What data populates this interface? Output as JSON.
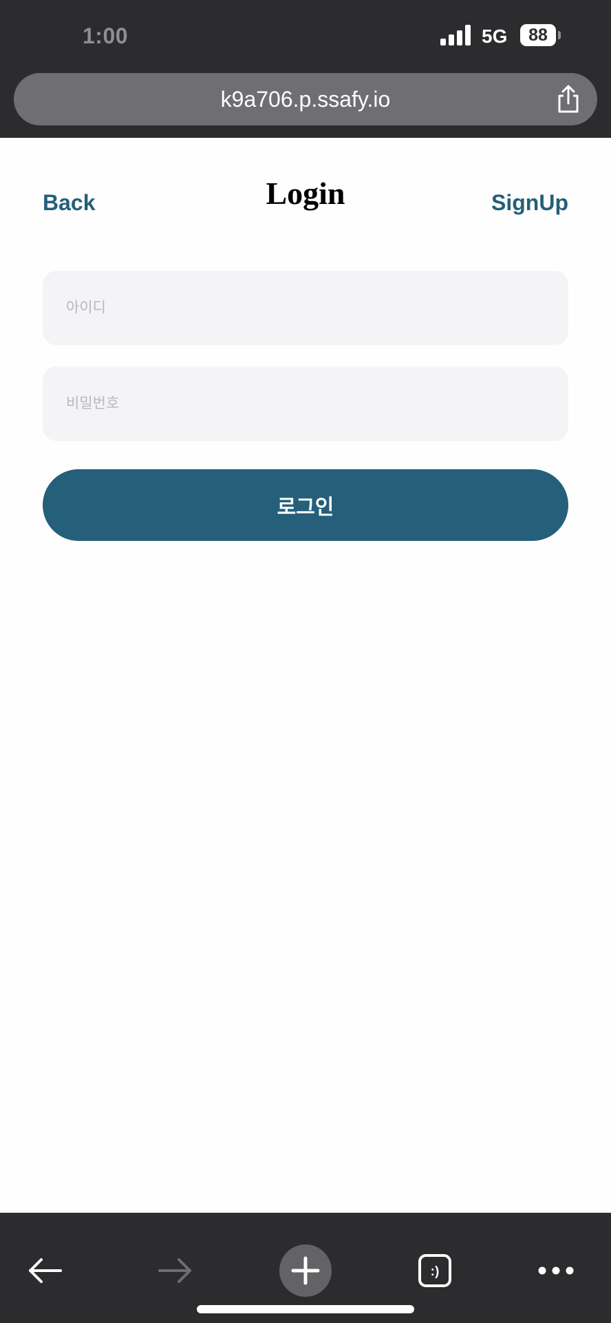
{
  "status_bar": {
    "time": "1:00",
    "network": "5G",
    "battery": "88",
    "signal_bars": 4
  },
  "browser": {
    "url": "k9a706.p.ssafy.io",
    "share_icon": "share-icon"
  },
  "header": {
    "back_label": "Back",
    "title": "Login",
    "signup_label": "SignUp"
  },
  "form": {
    "id_placeholder": "아이디",
    "id_value": "",
    "password_placeholder": "비밀번호",
    "password_value": "",
    "submit_label": "로그인"
  },
  "toolbar": {
    "icons": [
      "back-arrow-icon",
      "forward-arrow-icon",
      "plus-icon",
      "tabs-icon",
      "more-icon"
    ],
    "tabs_icon_text": ":)"
  },
  "colors": {
    "accent": "#255f79",
    "field_bg": "#f4f4f6",
    "chrome_bg": "#2c2c2e"
  }
}
